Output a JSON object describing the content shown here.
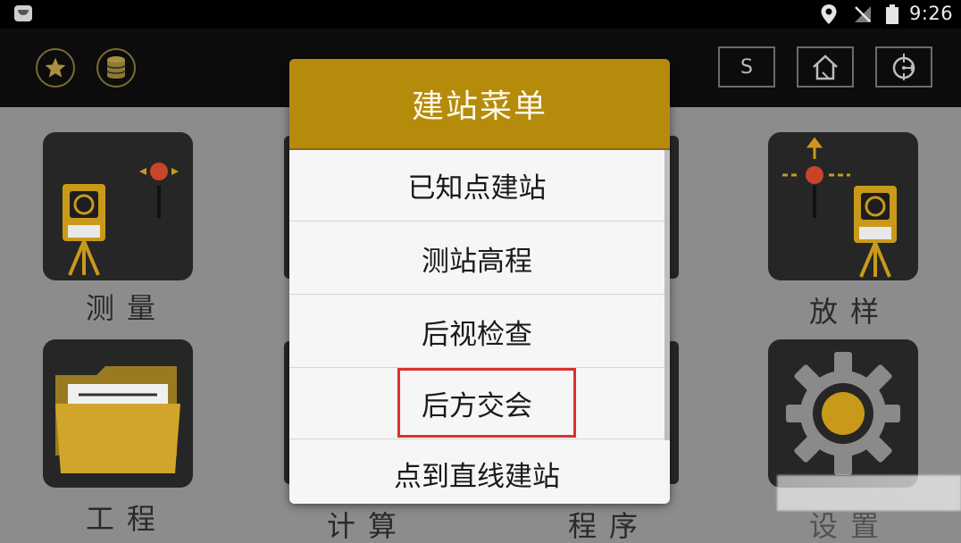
{
  "status_bar": {
    "time": "9:26",
    "icons": [
      "app-icon",
      "location-icon",
      "signal-icon",
      "battery-icon"
    ]
  },
  "toolbar": {
    "s_label": "S",
    "icons": [
      "star-icon",
      "database-icon",
      "home-icon",
      "target-icon"
    ]
  },
  "tiles": {
    "measure_label": "测量",
    "project_label": "工程",
    "stakeout_label": "放样",
    "settings_label": "设置",
    "calculate_label": "计算",
    "program_label": "程序"
  },
  "dialog": {
    "title": "建站菜单",
    "items": [
      {
        "label": "已知点建站"
      },
      {
        "label": "测站高程"
      },
      {
        "label": "后视检查"
      },
      {
        "label": "后方交会",
        "highlighted": true
      },
      {
        "label": "点到直线建站"
      }
    ]
  },
  "colors": {
    "dialog_header": "#b58b0c",
    "tile_background": "#262626",
    "highlight_border": "#d9322e",
    "dimmed_background": "#8c8c8c"
  }
}
